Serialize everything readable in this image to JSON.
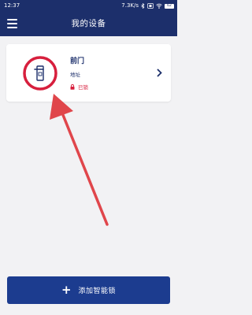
{
  "status_bar": {
    "time": "12:37",
    "network_speed": "7.3K/s",
    "battery_level": "62",
    "icons": [
      "bluetooth-icon",
      "sim-icon",
      "wifi-icon",
      "battery-icon"
    ]
  },
  "header": {
    "title": "我的设备",
    "menu_icon": "menu-icon"
  },
  "device": {
    "name": "前门",
    "address_label": "地址",
    "lock_state": "已锁",
    "lock_icon": "padlock-icon",
    "device_icon": "door-handle-icon",
    "chevron_icon": "chevron-right-icon"
  },
  "footer": {
    "add_button_label": "添加智能锁",
    "plus_icon": "plus-icon"
  },
  "colors": {
    "primary": "#1c2f6b",
    "button": "#1c3c8f",
    "locked": "#d71f3d",
    "annotation": "#e0464b",
    "background": "#f2f2f4"
  }
}
